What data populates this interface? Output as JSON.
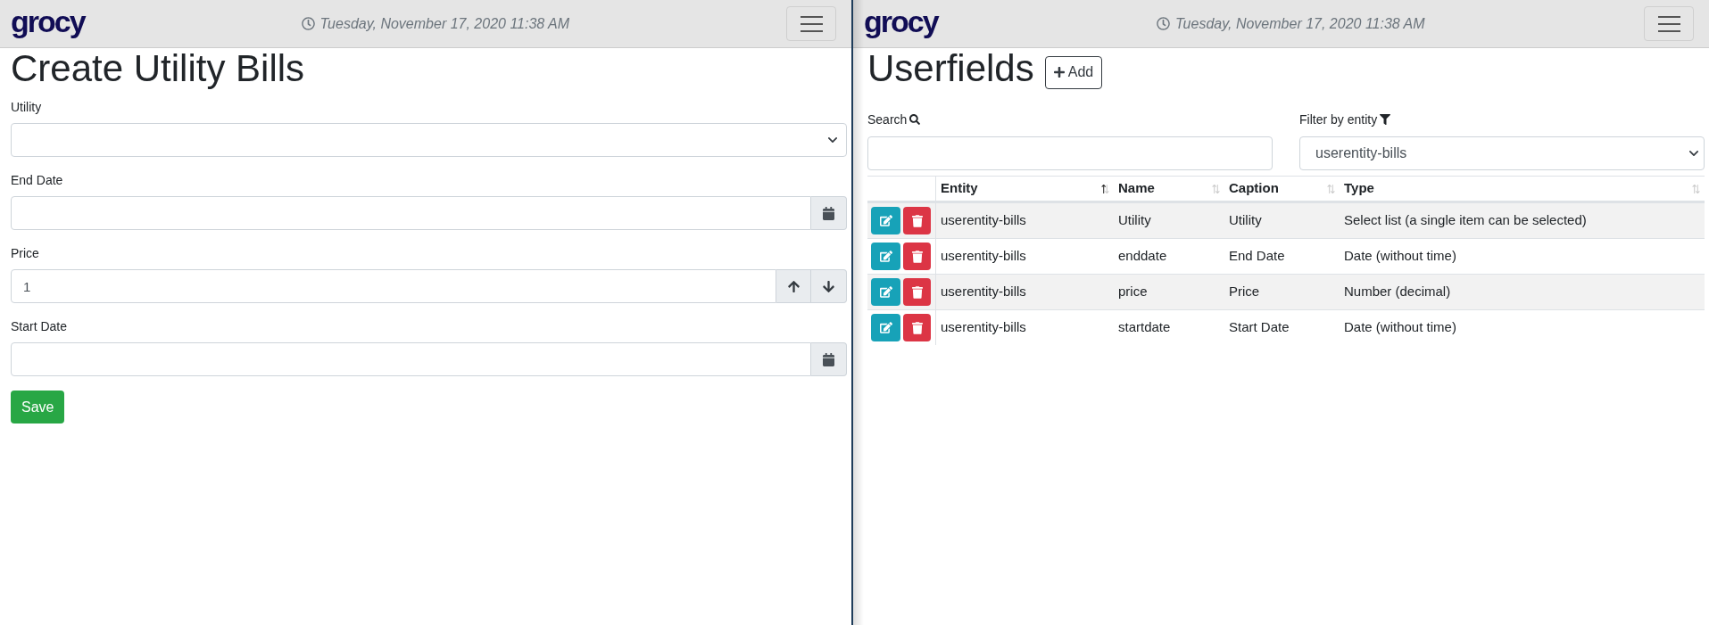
{
  "left_panel": {
    "header": {
      "logo": "grocy",
      "datetime": "Tuesday, November 17, 2020 11:38 AM"
    },
    "title": "Create Utility Bills",
    "fields": [
      {
        "kind": "select",
        "label": "Utility"
      },
      {
        "kind": "date",
        "label": "End Date"
      },
      {
        "kind": "number",
        "label": "Price",
        "value": "1"
      },
      {
        "kind": "date",
        "label": "Start Date"
      }
    ],
    "save_button": "Save"
  },
  "right_panel": {
    "header": {
      "logo": "grocy",
      "datetime": "Tuesday, November 17, 2020 11:38 AM"
    },
    "title": "Userfields",
    "add_button": "Add",
    "search": {
      "label": "Search"
    },
    "filter": {
      "label": "Filter by entity",
      "value": "userentity-bills"
    },
    "table": {
      "columns": [
        {
          "label": "Entity",
          "sorted": true
        },
        {
          "label": "Name",
          "sorted": false
        },
        {
          "label": "Caption",
          "sorted": false
        },
        {
          "label": "Type",
          "sorted": false
        }
      ],
      "rows": [
        {
          "cells": [
            "userentity-bills",
            "Utility",
            "Utility",
            "Select list (a single item can be selected)"
          ]
        },
        {
          "cells": [
            "userentity-bills",
            "enddate",
            "End Date",
            "Date (without time)"
          ]
        },
        {
          "cells": [
            "userentity-bills",
            "price",
            "Price",
            "Number (decimal)"
          ]
        },
        {
          "cells": [
            "userentity-bills",
            "startdate",
            "Start Date",
            "Date (without time)"
          ]
        }
      ]
    }
  }
}
